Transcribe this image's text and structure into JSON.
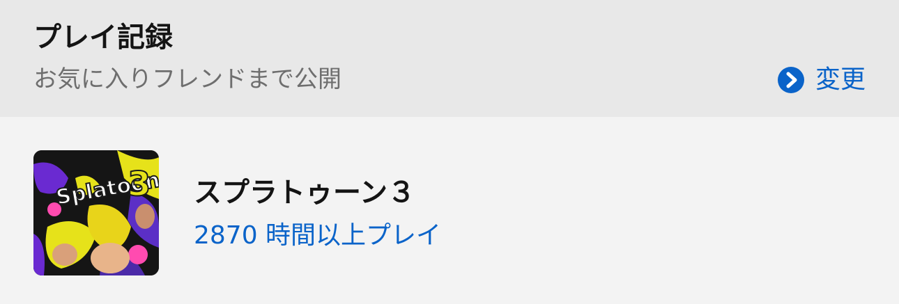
{
  "section": {
    "title": "プレイ記録",
    "visibility": "お気に入りフレンドまで公開",
    "change_label": "変更",
    "change_icon": "chevron-right-circle-icon",
    "accent_color": "#0a63c9"
  },
  "game": {
    "name": "スプラトゥーン３",
    "play_time": "2870 時間以上プレイ",
    "thumbnail": {
      "logo_text": "Splatoon",
      "logo_number": "3"
    }
  }
}
